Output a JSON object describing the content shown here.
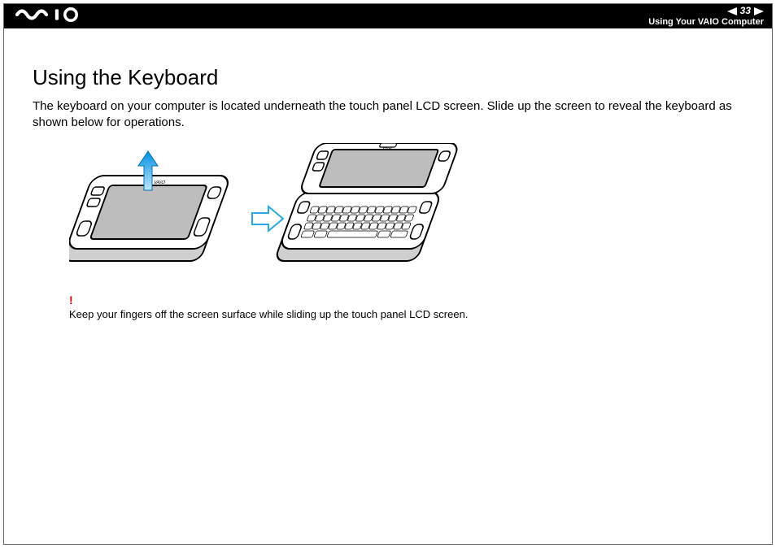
{
  "header": {
    "logo_alt": "VAIO",
    "page_number": "33",
    "section_label": "Using Your VAIO Computer"
  },
  "content": {
    "title": "Using the Keyboard",
    "paragraph": "The keyboard on your computer is located underneath the touch panel LCD screen. Slide up the screen to reveal the keyboard as shown below for operations.",
    "note_mark": "!",
    "note_text": "Keep your fingers off the screen surface while sliding up the touch panel LCD screen."
  }
}
